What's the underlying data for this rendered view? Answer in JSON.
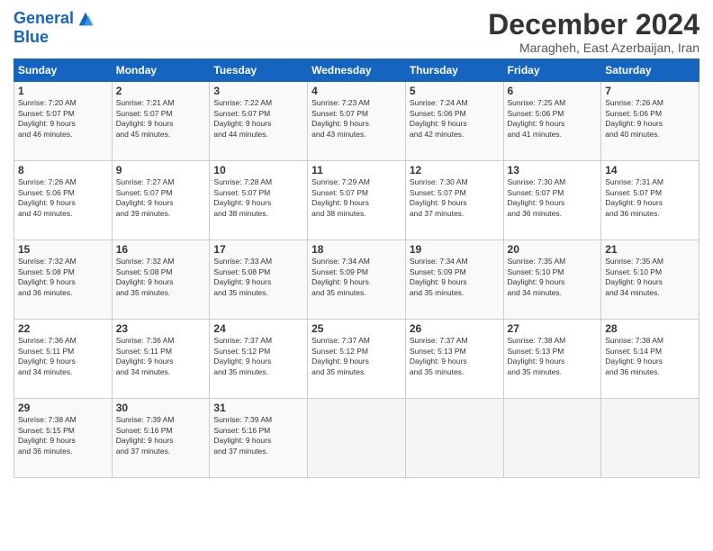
{
  "logo": {
    "line1": "General",
    "line2": "Blue"
  },
  "title": "December 2024",
  "subtitle": "Maragheh, East Azerbaijan, Iran",
  "days_header": [
    "Sunday",
    "Monday",
    "Tuesday",
    "Wednesday",
    "Thursday",
    "Friday",
    "Saturday"
  ],
  "weeks": [
    [
      {
        "day": "1",
        "info": "Sunrise: 7:20 AM\nSunset: 5:07 PM\nDaylight: 9 hours\nand 46 minutes."
      },
      {
        "day": "2",
        "info": "Sunrise: 7:21 AM\nSunset: 5:07 PM\nDaylight: 9 hours\nand 45 minutes."
      },
      {
        "day": "3",
        "info": "Sunrise: 7:22 AM\nSunset: 5:07 PM\nDaylight: 9 hours\nand 44 minutes."
      },
      {
        "day": "4",
        "info": "Sunrise: 7:23 AM\nSunset: 5:07 PM\nDaylight: 9 hours\nand 43 minutes."
      },
      {
        "day": "5",
        "info": "Sunrise: 7:24 AM\nSunset: 5:06 PM\nDaylight: 9 hours\nand 42 minutes."
      },
      {
        "day": "6",
        "info": "Sunrise: 7:25 AM\nSunset: 5:06 PM\nDaylight: 9 hours\nand 41 minutes."
      },
      {
        "day": "7",
        "info": "Sunrise: 7:26 AM\nSunset: 5:06 PM\nDaylight: 9 hours\nand 40 minutes."
      }
    ],
    [
      {
        "day": "8",
        "info": "Sunrise: 7:26 AM\nSunset: 5:06 PM\nDaylight: 9 hours\nand 40 minutes."
      },
      {
        "day": "9",
        "info": "Sunrise: 7:27 AM\nSunset: 5:07 PM\nDaylight: 9 hours\nand 39 minutes."
      },
      {
        "day": "10",
        "info": "Sunrise: 7:28 AM\nSunset: 5:07 PM\nDaylight: 9 hours\nand 38 minutes."
      },
      {
        "day": "11",
        "info": "Sunrise: 7:29 AM\nSunset: 5:07 PM\nDaylight: 9 hours\nand 38 minutes."
      },
      {
        "day": "12",
        "info": "Sunrise: 7:30 AM\nSunset: 5:07 PM\nDaylight: 9 hours\nand 37 minutes."
      },
      {
        "day": "13",
        "info": "Sunrise: 7:30 AM\nSunset: 5:07 PM\nDaylight: 9 hours\nand 36 minutes."
      },
      {
        "day": "14",
        "info": "Sunrise: 7:31 AM\nSunset: 5:07 PM\nDaylight: 9 hours\nand 36 minutes."
      }
    ],
    [
      {
        "day": "15",
        "info": "Sunrise: 7:32 AM\nSunset: 5:08 PM\nDaylight: 9 hours\nand 36 minutes."
      },
      {
        "day": "16",
        "info": "Sunrise: 7:32 AM\nSunset: 5:08 PM\nDaylight: 9 hours\nand 35 minutes."
      },
      {
        "day": "17",
        "info": "Sunrise: 7:33 AM\nSunset: 5:08 PM\nDaylight: 9 hours\nand 35 minutes."
      },
      {
        "day": "18",
        "info": "Sunrise: 7:34 AM\nSunset: 5:09 PM\nDaylight: 9 hours\nand 35 minutes."
      },
      {
        "day": "19",
        "info": "Sunrise: 7:34 AM\nSunset: 5:09 PM\nDaylight: 9 hours\nand 35 minutes."
      },
      {
        "day": "20",
        "info": "Sunrise: 7:35 AM\nSunset: 5:10 PM\nDaylight: 9 hours\nand 34 minutes."
      },
      {
        "day": "21",
        "info": "Sunrise: 7:35 AM\nSunset: 5:10 PM\nDaylight: 9 hours\nand 34 minutes."
      }
    ],
    [
      {
        "day": "22",
        "info": "Sunrise: 7:36 AM\nSunset: 5:11 PM\nDaylight: 9 hours\nand 34 minutes."
      },
      {
        "day": "23",
        "info": "Sunrise: 7:36 AM\nSunset: 5:11 PM\nDaylight: 9 hours\nand 34 minutes."
      },
      {
        "day": "24",
        "info": "Sunrise: 7:37 AM\nSunset: 5:12 PM\nDaylight: 9 hours\nand 35 minutes."
      },
      {
        "day": "25",
        "info": "Sunrise: 7:37 AM\nSunset: 5:12 PM\nDaylight: 9 hours\nand 35 minutes."
      },
      {
        "day": "26",
        "info": "Sunrise: 7:37 AM\nSunset: 5:13 PM\nDaylight: 9 hours\nand 35 minutes."
      },
      {
        "day": "27",
        "info": "Sunrise: 7:38 AM\nSunset: 5:13 PM\nDaylight: 9 hours\nand 35 minutes."
      },
      {
        "day": "28",
        "info": "Sunrise: 7:38 AM\nSunset: 5:14 PM\nDaylight: 9 hours\nand 36 minutes."
      }
    ],
    [
      {
        "day": "29",
        "info": "Sunrise: 7:38 AM\nSunset: 5:15 PM\nDaylight: 9 hours\nand 36 minutes."
      },
      {
        "day": "30",
        "info": "Sunrise: 7:39 AM\nSunset: 5:16 PM\nDaylight: 9 hours\nand 37 minutes."
      },
      {
        "day": "31",
        "info": "Sunrise: 7:39 AM\nSunset: 5:16 PM\nDaylight: 9 hours\nand 37 minutes."
      },
      {
        "day": "",
        "info": ""
      },
      {
        "day": "",
        "info": ""
      },
      {
        "day": "",
        "info": ""
      },
      {
        "day": "",
        "info": ""
      }
    ]
  ]
}
